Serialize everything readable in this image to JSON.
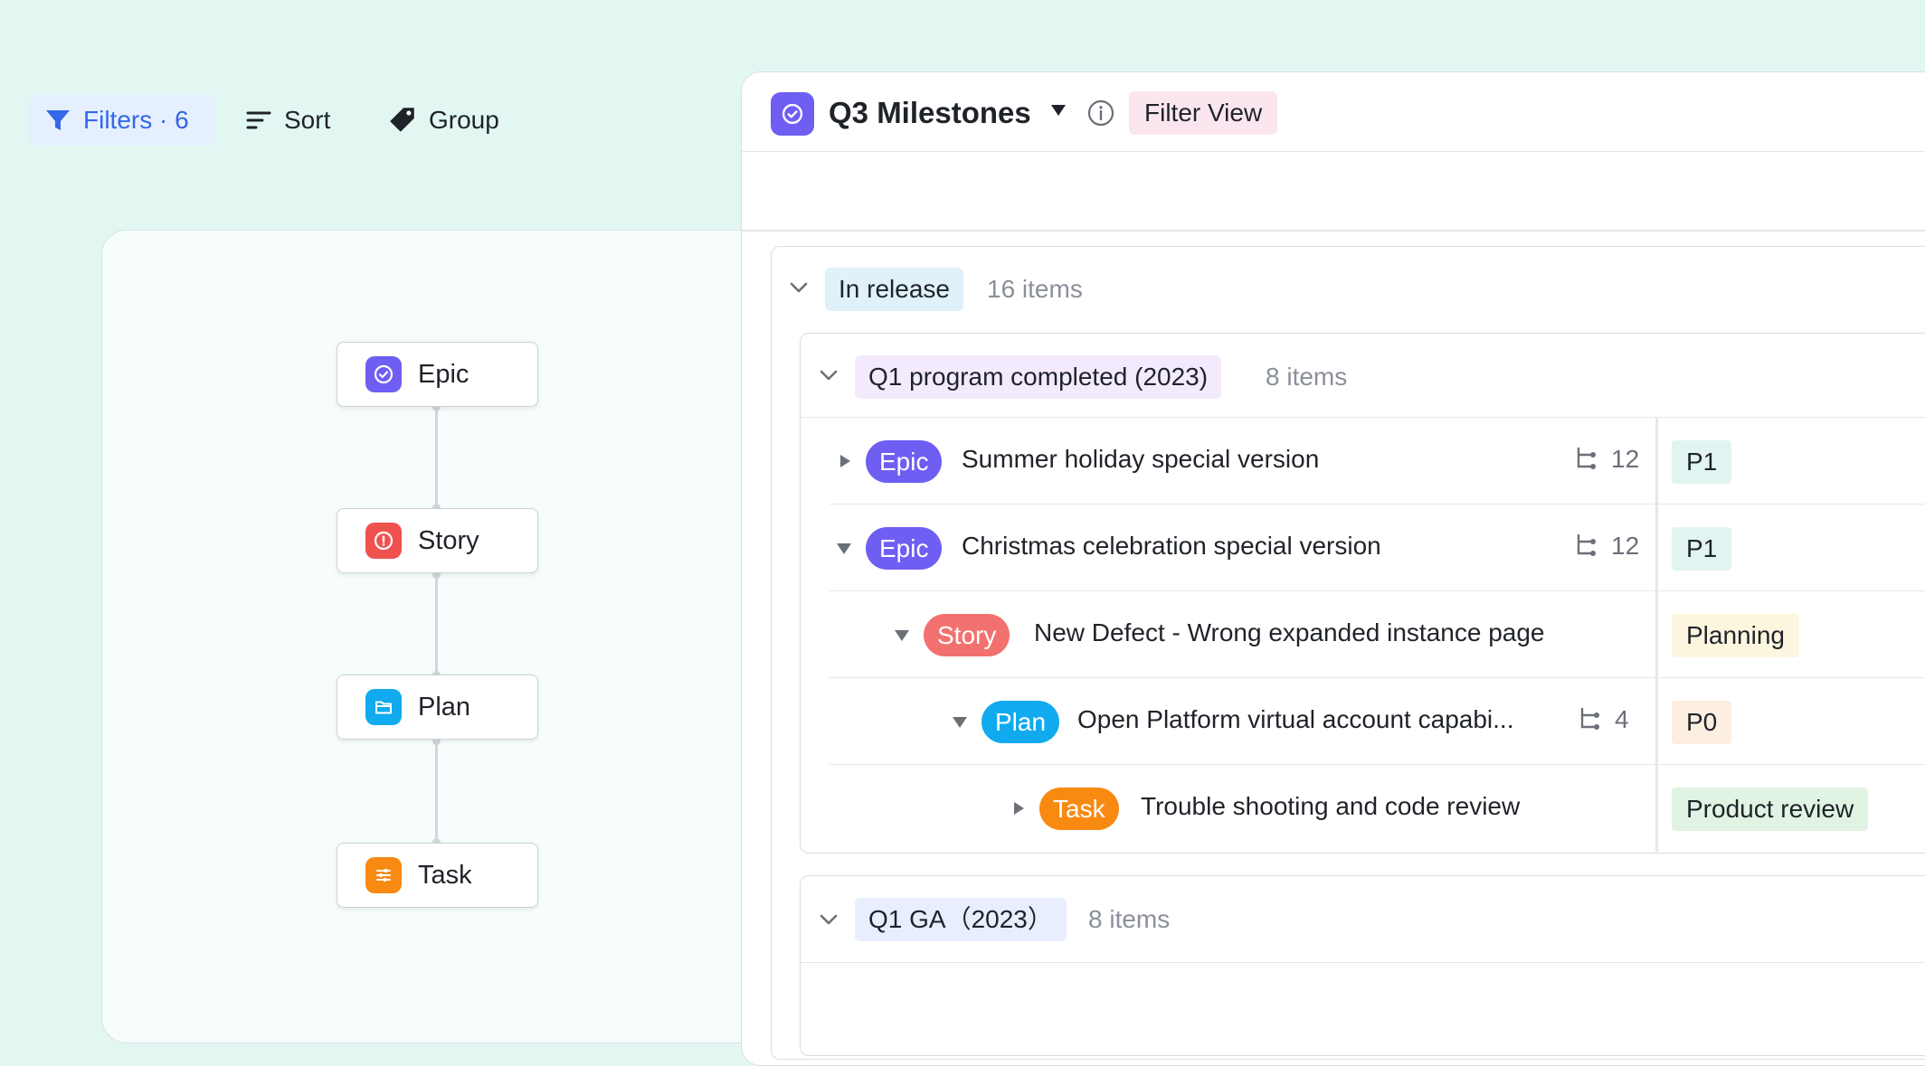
{
  "hierarchy": {
    "nodes": [
      {
        "label": "Epic",
        "icon": "check-circle-icon",
        "color": "#6f5ef2"
      },
      {
        "label": "Story",
        "icon": "alert-circle-icon",
        "color": "#f0514f"
      },
      {
        "label": "Plan",
        "icon": "folder-icon",
        "color": "#11aaee"
      },
      {
        "label": "Task",
        "icon": "sliders-icon",
        "color": "#f88a12"
      }
    ]
  },
  "view": {
    "title": "Q3 Milestones",
    "filter_view_label": "Filter View",
    "accent": "#6f5ef2"
  },
  "toolbar": {
    "filters_label": "Filters · 6",
    "sort_label": "Sort",
    "group_label": "Group"
  },
  "groups": [
    {
      "label": "In release",
      "count": "16 items",
      "subgroups": [
        {
          "label": "Q1 program completed (2023)",
          "count": "8 items",
          "rows": [
            {
              "type": "Epic",
              "title": "Summer holiday special version",
              "subitems": "12",
              "status": "P1",
              "expanded": false
            },
            {
              "type": "Epic",
              "title": "Christmas celebration special version",
              "subitems": "12",
              "status": "P1",
              "expanded": true
            },
            {
              "type": "Story",
              "title": "New Defect - Wrong expanded instance page",
              "subitems": "",
              "status": "Planning",
              "expanded": true
            },
            {
              "type": "Plan",
              "title": "Open Platform virtual account capabi...",
              "subitems": "4",
              "status": "P0",
              "expanded": true
            },
            {
              "type": "Task",
              "title": "Trouble shooting and code review",
              "subitems": "",
              "status": "Product review",
              "expanded": false
            }
          ]
        },
        {
          "label": "Q1 GA（2023）",
          "count": "8 items"
        }
      ]
    }
  ],
  "colors": {
    "epic": "#6f5ef2",
    "story": "#f2716f",
    "plan": "#11aaee",
    "task": "#f88a12",
    "status_p1": "#e1f4f1",
    "status_planning": "#fdf6df",
    "status_p0": "#fdeee2",
    "status_review": "#e1f3e3"
  }
}
